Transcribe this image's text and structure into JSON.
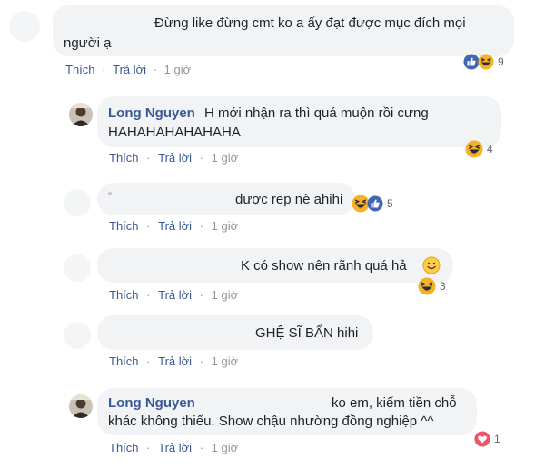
{
  "comments": [
    {
      "id": "c1",
      "author": "",
      "text_line1": "Đừng like đừng cmt ko a ấy đạt được mục đích mọi",
      "text_line2": "người ạ",
      "actions": {
        "like": "Thích",
        "reply": "Trả lời",
        "time": "1 giờ"
      },
      "reactions": {
        "icons": [
          "like-icon",
          "haha-icon"
        ],
        "count": "9"
      }
    },
    {
      "id": "c2",
      "author": "Long Nguyen",
      "text_line1": "H mới nhận ra thì quá muộn rồi cưng",
      "text_line2": "HAHAHAHAHAHAHA",
      "actions": {
        "like": "Thích",
        "reply": "Trả lời",
        "time": "1 giờ"
      },
      "reactions": {
        "icons": [
          "haha-icon"
        ],
        "count": "4"
      }
    },
    {
      "id": "c3",
      "author": "",
      "text_line1": "được rep nè ahihi",
      "actions": {
        "like": "Thích",
        "reply": "Trả lời",
        "time": "1 giờ"
      },
      "reactions": {
        "icons": [
          "haha-icon",
          "like-icon"
        ],
        "count": "5"
      }
    },
    {
      "id": "c4",
      "author": "",
      "text_line1": "K có show nên rãnh quá hả",
      "emoji": "smile-emoji",
      "actions": {
        "like": "Thích",
        "reply": "Trả lời",
        "time": "1 giờ"
      },
      "reactions": {
        "icons": [
          "haha-icon"
        ],
        "count": "3"
      }
    },
    {
      "id": "c5",
      "author": "",
      "text_line1": "GHỆ SĨ BẨN hihi",
      "actions": {
        "like": "Thích",
        "reply": "Trả lời",
        "time": "1 giờ"
      }
    },
    {
      "id": "c6",
      "author": "Long Nguyen",
      "text_line1": "ko em, kiếm tiền chỗ",
      "text_line2": "khác không thiếu. Show chậu nhường đồng nghiệp ^^",
      "actions": {
        "like": "Thích",
        "reply": "Trả lời",
        "time": "1 giờ"
      },
      "reactions": {
        "icons": [
          "love-icon"
        ],
        "count": "1"
      }
    }
  ],
  "colors": {
    "link": "#385898",
    "meta": "#90949c",
    "bubble": "#f2f3f5",
    "like": "#4267b2",
    "haha": "#f7b125",
    "love": "#f25268"
  },
  "separator": "·"
}
